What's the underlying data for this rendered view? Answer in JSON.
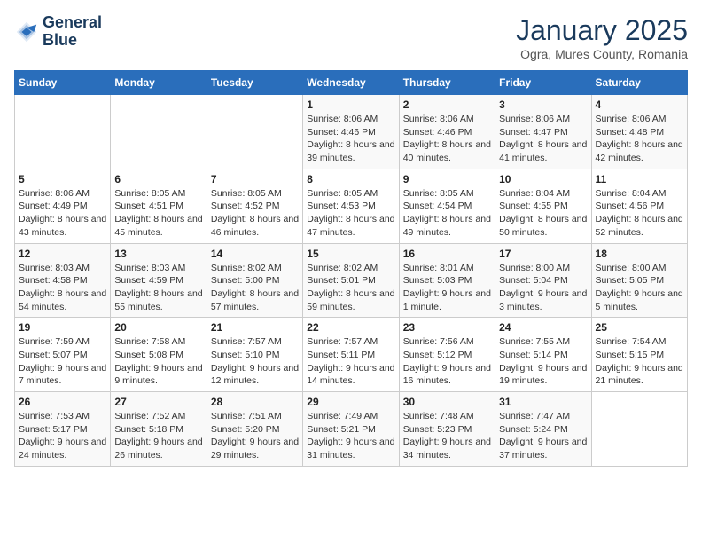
{
  "logo": {
    "line1": "General",
    "line2": "Blue"
  },
  "title": "January 2025",
  "subtitle": "Ogra, Mures County, Romania",
  "weekdays": [
    "Sunday",
    "Monday",
    "Tuesday",
    "Wednesday",
    "Thursday",
    "Friday",
    "Saturday"
  ],
  "weeks": [
    [
      {
        "day": "",
        "info": ""
      },
      {
        "day": "",
        "info": ""
      },
      {
        "day": "",
        "info": ""
      },
      {
        "day": "1",
        "info": "Sunrise: 8:06 AM\nSunset: 4:46 PM\nDaylight: 8 hours and 39 minutes."
      },
      {
        "day": "2",
        "info": "Sunrise: 8:06 AM\nSunset: 4:46 PM\nDaylight: 8 hours and 40 minutes."
      },
      {
        "day": "3",
        "info": "Sunrise: 8:06 AM\nSunset: 4:47 PM\nDaylight: 8 hours and 41 minutes."
      },
      {
        "day": "4",
        "info": "Sunrise: 8:06 AM\nSunset: 4:48 PM\nDaylight: 8 hours and 42 minutes."
      }
    ],
    [
      {
        "day": "5",
        "info": "Sunrise: 8:06 AM\nSunset: 4:49 PM\nDaylight: 8 hours and 43 minutes."
      },
      {
        "day": "6",
        "info": "Sunrise: 8:05 AM\nSunset: 4:51 PM\nDaylight: 8 hours and 45 minutes."
      },
      {
        "day": "7",
        "info": "Sunrise: 8:05 AM\nSunset: 4:52 PM\nDaylight: 8 hours and 46 minutes."
      },
      {
        "day": "8",
        "info": "Sunrise: 8:05 AM\nSunset: 4:53 PM\nDaylight: 8 hours and 47 minutes."
      },
      {
        "day": "9",
        "info": "Sunrise: 8:05 AM\nSunset: 4:54 PM\nDaylight: 8 hours and 49 minutes."
      },
      {
        "day": "10",
        "info": "Sunrise: 8:04 AM\nSunset: 4:55 PM\nDaylight: 8 hours and 50 minutes."
      },
      {
        "day": "11",
        "info": "Sunrise: 8:04 AM\nSunset: 4:56 PM\nDaylight: 8 hours and 52 minutes."
      }
    ],
    [
      {
        "day": "12",
        "info": "Sunrise: 8:03 AM\nSunset: 4:58 PM\nDaylight: 8 hours and 54 minutes."
      },
      {
        "day": "13",
        "info": "Sunrise: 8:03 AM\nSunset: 4:59 PM\nDaylight: 8 hours and 55 minutes."
      },
      {
        "day": "14",
        "info": "Sunrise: 8:02 AM\nSunset: 5:00 PM\nDaylight: 8 hours and 57 minutes."
      },
      {
        "day": "15",
        "info": "Sunrise: 8:02 AM\nSunset: 5:01 PM\nDaylight: 8 hours and 59 minutes."
      },
      {
        "day": "16",
        "info": "Sunrise: 8:01 AM\nSunset: 5:03 PM\nDaylight: 9 hours and 1 minute."
      },
      {
        "day": "17",
        "info": "Sunrise: 8:00 AM\nSunset: 5:04 PM\nDaylight: 9 hours and 3 minutes."
      },
      {
        "day": "18",
        "info": "Sunrise: 8:00 AM\nSunset: 5:05 PM\nDaylight: 9 hours and 5 minutes."
      }
    ],
    [
      {
        "day": "19",
        "info": "Sunrise: 7:59 AM\nSunset: 5:07 PM\nDaylight: 9 hours and 7 minutes."
      },
      {
        "day": "20",
        "info": "Sunrise: 7:58 AM\nSunset: 5:08 PM\nDaylight: 9 hours and 9 minutes."
      },
      {
        "day": "21",
        "info": "Sunrise: 7:57 AM\nSunset: 5:10 PM\nDaylight: 9 hours and 12 minutes."
      },
      {
        "day": "22",
        "info": "Sunrise: 7:57 AM\nSunset: 5:11 PM\nDaylight: 9 hours and 14 minutes."
      },
      {
        "day": "23",
        "info": "Sunrise: 7:56 AM\nSunset: 5:12 PM\nDaylight: 9 hours and 16 minutes."
      },
      {
        "day": "24",
        "info": "Sunrise: 7:55 AM\nSunset: 5:14 PM\nDaylight: 9 hours and 19 minutes."
      },
      {
        "day": "25",
        "info": "Sunrise: 7:54 AM\nSunset: 5:15 PM\nDaylight: 9 hours and 21 minutes."
      }
    ],
    [
      {
        "day": "26",
        "info": "Sunrise: 7:53 AM\nSunset: 5:17 PM\nDaylight: 9 hours and 24 minutes."
      },
      {
        "day": "27",
        "info": "Sunrise: 7:52 AM\nSunset: 5:18 PM\nDaylight: 9 hours and 26 minutes."
      },
      {
        "day": "28",
        "info": "Sunrise: 7:51 AM\nSunset: 5:20 PM\nDaylight: 9 hours and 29 minutes."
      },
      {
        "day": "29",
        "info": "Sunrise: 7:49 AM\nSunset: 5:21 PM\nDaylight: 9 hours and 31 minutes."
      },
      {
        "day": "30",
        "info": "Sunrise: 7:48 AM\nSunset: 5:23 PM\nDaylight: 9 hours and 34 minutes."
      },
      {
        "day": "31",
        "info": "Sunrise: 7:47 AM\nSunset: 5:24 PM\nDaylight: 9 hours and 37 minutes."
      },
      {
        "day": "",
        "info": ""
      }
    ]
  ]
}
